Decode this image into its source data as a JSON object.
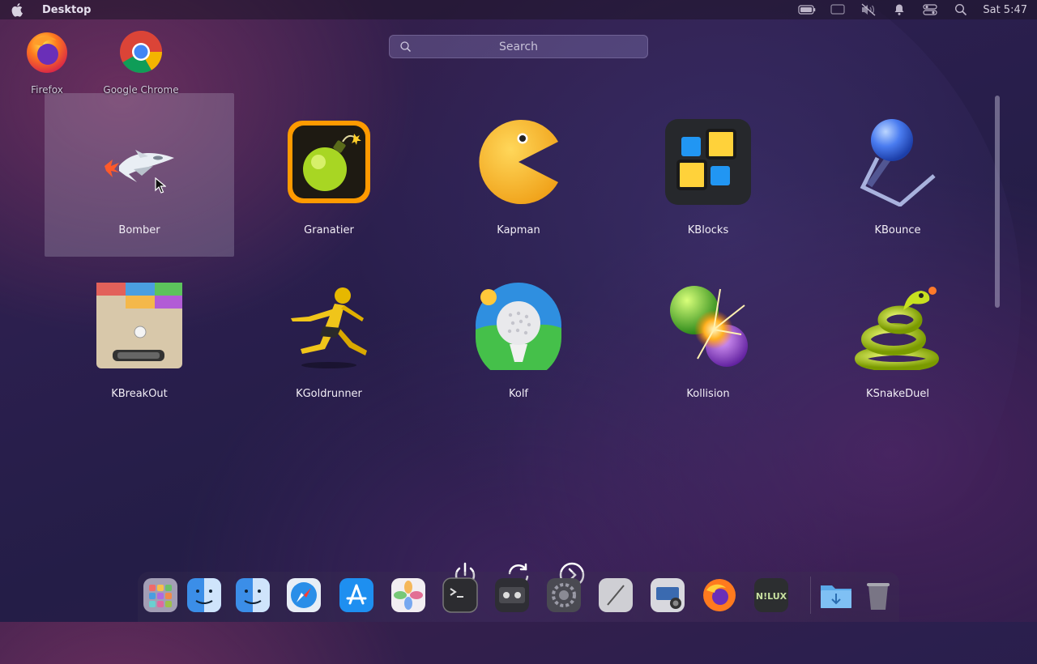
{
  "menubar": {
    "title": "Desktop",
    "clock": "Sat 5:47",
    "tray_icons": [
      "battery-icon",
      "display-icon",
      "mute-icon",
      "notification-bell-icon",
      "control-center-icon",
      "search-icon"
    ]
  },
  "desktop": {
    "icons": [
      {
        "label": "Firefox",
        "icon": "firefox-icon"
      },
      {
        "label": "Google Chrome",
        "icon": "chrome-icon"
      }
    ]
  },
  "search": {
    "placeholder": "Search"
  },
  "launcher": {
    "apps": [
      {
        "label": "Bomber",
        "icon": "bomber-icon",
        "selected": true
      },
      {
        "label": "Granatier",
        "icon": "granatier-icon"
      },
      {
        "label": "Kapman",
        "icon": "kapman-icon"
      },
      {
        "label": "KBlocks",
        "icon": "kblocks-icon"
      },
      {
        "label": "KBounce",
        "icon": "kbounce-icon"
      },
      {
        "label": "KBreakOut",
        "icon": "kbreakout-icon"
      },
      {
        "label": "KGoldrunner",
        "icon": "kgoldrunner-icon"
      },
      {
        "label": "Kolf",
        "icon": "kolf-icon"
      },
      {
        "label": "Kollision",
        "icon": "kollision-icon"
      },
      {
        "label": "KSnakeDuel",
        "icon": "ksnakeduel-icon"
      }
    ]
  },
  "power": [
    "power-icon",
    "restart-icon",
    "next-icon"
  ],
  "dock": {
    "items": [
      "launchpad-icon",
      "finder-icon",
      "finder-icon",
      "safari-icon",
      "app-store-icon",
      "photos-icon",
      "terminal-icon",
      "cassette-icon",
      "system-settings-icon",
      "notes-icon",
      "screenshot-icon",
      "firefox-icon",
      "nilux-icon",
      "downloads-folder-icon",
      "trash-icon"
    ]
  }
}
